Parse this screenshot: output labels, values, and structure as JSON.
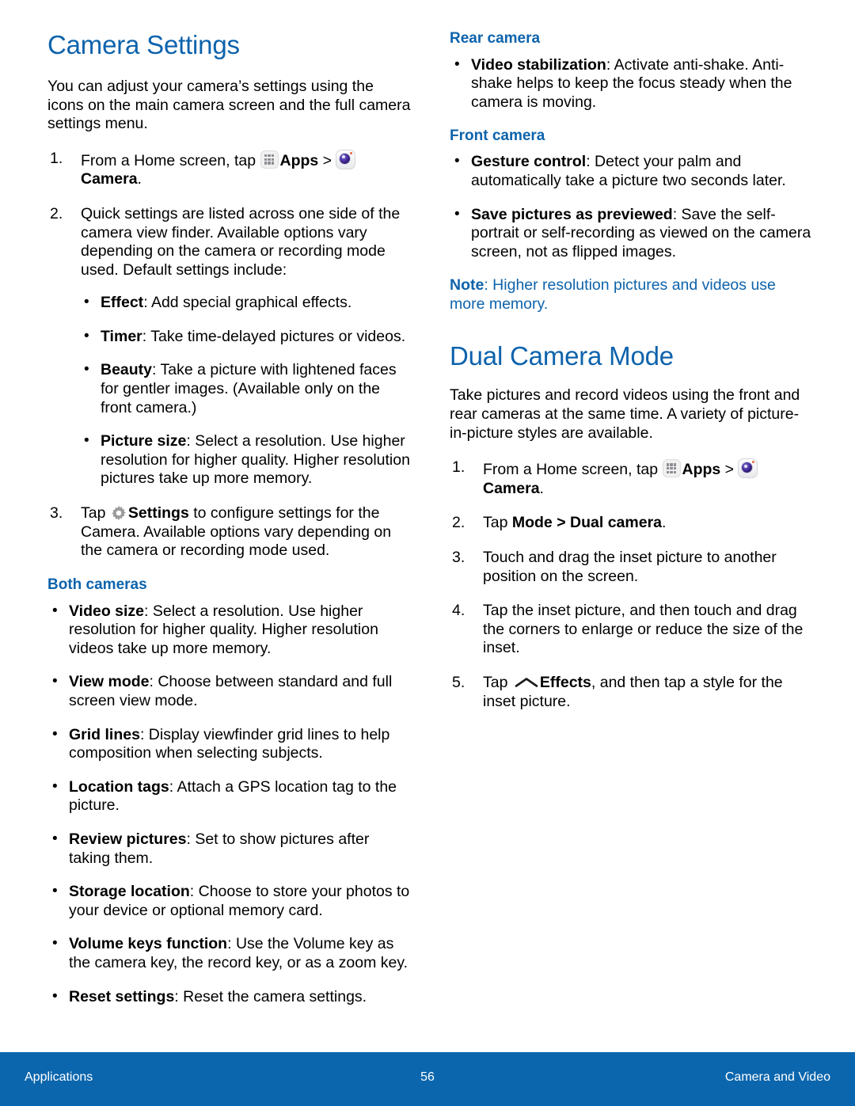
{
  "colors": {
    "heading_blue": "#0d63ac",
    "footer_blue": "#0b66ad",
    "body_black": "#000000"
  },
  "left_column": {
    "title": "Camera Settings",
    "intro": "You can adjust your camera’s settings using the icons on the main camera screen and the full camera settings menu.",
    "steps": [
      {
        "num": "1.",
        "pre": "From a Home screen, tap ",
        "apps_icon": "apps-icon",
        "apps_label": "Apps",
        "sep": " > ",
        "camera_icon": "camera-icon",
        "camera_label": "Camera",
        "post": "."
      },
      {
        "num": "2.",
        "text": "Quick settings are listed across one side of the camera view finder. Available options vary depending on the camera or recording mode used. Default settings include:",
        "bullets": [
          {
            "lead": "Effect",
            "rest": ": Add special graphical effects."
          },
          {
            "lead": "Timer",
            "rest": ": Take time-delayed pictures or videos."
          },
          {
            "lead": "Beauty",
            "rest": ": Take a picture with lightened faces for gentler images. (Available only on the front camera.)"
          },
          {
            "lead": "Picture size",
            "rest": ": Select a resolution. Use higher resolution for higher quality. Higher resolution pictures take up more memory."
          }
        ]
      },
      {
        "num": "3.",
        "pre": "Tap ",
        "gear_icon": "gear-icon",
        "gear_label": "Settings",
        "post": " to configure settings for the Camera. Available options vary depending on the camera or recording mode used."
      }
    ],
    "both_cameras_heading": "Both cameras",
    "both_cameras_bullets": [
      {
        "lead": "Video size",
        "rest": ": Select a resolution. Use higher resolution for higher quality. Higher resolution videos take up more memory."
      },
      {
        "lead": "View mode",
        "rest": ": Choose between standard and full screen view mode."
      },
      {
        "lead": "Grid lines",
        "rest": ": Display viewfinder grid lines to help composition when selecting subjects."
      },
      {
        "lead": "Location tags",
        "rest": ": Attach a GPS location tag to the picture."
      },
      {
        "lead": "Review pictures",
        "rest": ": Set to show pictures after taking them."
      },
      {
        "lead": "Storage location",
        "rest": ": Choose to store your photos to your device or optional memory card."
      },
      {
        "lead": "Volume keys function",
        "rest": ": Use the Volume key as the camera key, the record key, or as a zoom key."
      },
      {
        "lead": "Reset settings",
        "rest": ": Reset the camera settings."
      }
    ]
  },
  "right_column": {
    "rear_camera_heading": "Rear camera",
    "rear_camera_bullets": [
      {
        "lead": "Video stabilization",
        "rest": ": Activate anti-shake. Anti-shake helps to keep the focus steady when the camera is moving."
      }
    ],
    "front_camera_heading": "Front camera",
    "front_camera_bullets": [
      {
        "lead": "Gesture control",
        "rest": ": Detect your palm and automatically take a picture two seconds later."
      },
      {
        "lead": "Save pictures as previewed",
        "rest": ": Save the self-portrait or self-recording as viewed on the camera screen, not as flipped images."
      }
    ],
    "note": {
      "lead": "Note",
      "rest": ": Higher resolution pictures and videos use more memory."
    },
    "title": "Dual Camera Mode",
    "intro": "Take pictures and record videos using the front and rear cameras at the same time. A variety of picture-in-picture styles are available.",
    "steps": [
      {
        "num": "1.",
        "pre": "From a Home screen, tap ",
        "apps_icon": "apps-icon",
        "apps_label": "Apps",
        "sep": " > ",
        "camera_icon": "camera-icon",
        "camera_label": "Camera",
        "post": "."
      },
      {
        "num": "2.",
        "pre": "Tap ",
        "bold_a": "Mode",
        "mid": " > ",
        "bold_b": "Dual camera",
        "post": "."
      },
      {
        "num": "3.",
        "text": "Touch and drag the inset picture to another position on the screen."
      },
      {
        "num": "4.",
        "text": "Tap the inset picture, and then touch and drag the corners to enlarge or reduce the size of the inset."
      },
      {
        "num": "5.",
        "pre": "Tap ",
        "effects_icon": "effects-icon",
        "effects_label": "Effects",
        "post": ", and then tap a style for the inset picture."
      }
    ]
  },
  "footer": {
    "left": "Applications",
    "page_number": "56",
    "right": "Camera and Video"
  }
}
